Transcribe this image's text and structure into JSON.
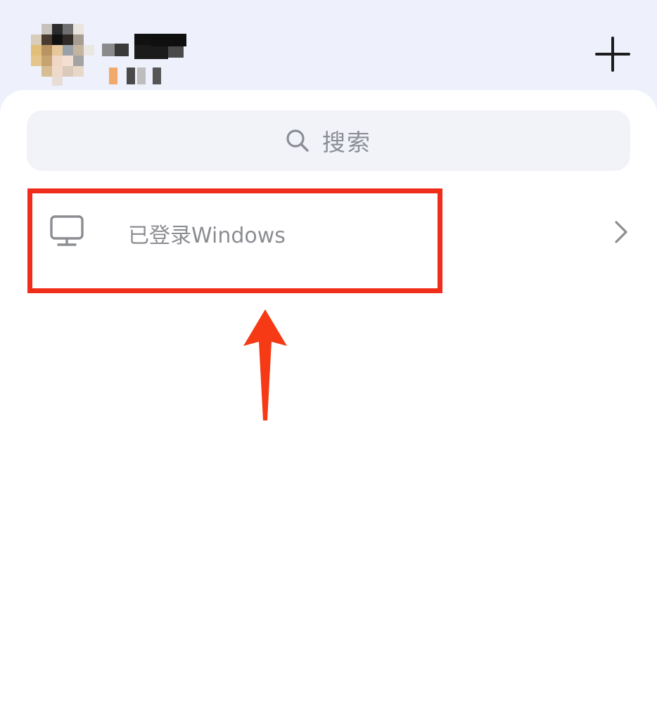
{
  "header": {
    "avatar_icon": "user-avatar-icon",
    "add_icon": "plus-icon"
  },
  "search": {
    "icon": "search-icon",
    "label": "搜索"
  },
  "device_row": {
    "icon": "monitor-icon",
    "label": "已登录Windows",
    "chevron_icon": "chevron-right-icon"
  },
  "annotation": {
    "highlight_color": "#f02d1b",
    "arrow_color": "#f53a15",
    "arrow_direction": "up"
  },
  "colors": {
    "top_background": "#eef1fb",
    "sheet_background": "#ffffff",
    "search_background": "#f1f3f8",
    "muted_text": "#8b8d92"
  }
}
